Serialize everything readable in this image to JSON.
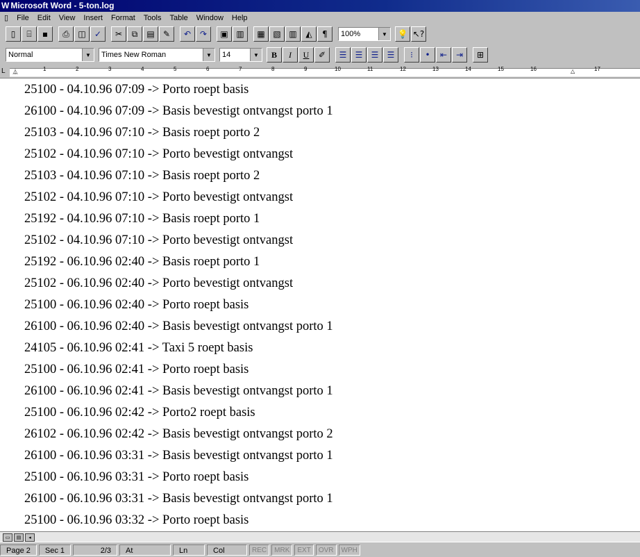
{
  "window": {
    "title": "Microsoft Word - 5-ton.log"
  },
  "menu": [
    "File",
    "Edit",
    "View",
    "Insert",
    "Format",
    "Tools",
    "Table",
    "Window",
    "Help"
  ],
  "toolbar_standard": {
    "icons": [
      "new-doc-icon",
      "open-icon",
      "save-icon",
      "print-icon",
      "print-preview-icon",
      "spelling-icon",
      "cut-icon",
      "copy-icon",
      "paste-icon",
      "format-painter-icon",
      "undo-icon",
      "redo-icon",
      "autoformat-icon",
      "insert-address-icon",
      "insert-table-icon",
      "insert-excel-icon",
      "columns-icon",
      "drawing-icon",
      "show-hide-icon",
      "help-icon"
    ],
    "zoom": "100%"
  },
  "toolbar_formatting": {
    "style": "Normal",
    "font": "Times New Roman",
    "size": "14",
    "bold": "B",
    "italic": "I",
    "underline": "U"
  },
  "ruler": {
    "numbers": [
      "1",
      "2",
      "3",
      "4",
      "5",
      "6",
      "7",
      "8",
      "9",
      "10",
      "11",
      "12",
      "13",
      "14",
      "15",
      "16",
      "17"
    ]
  },
  "document": {
    "lines": [
      "25100 - 04.10.96 07:09 -> Porto roept basis",
      "26100 - 04.10.96 07:09 -> Basis bevestigt ontvangst porto 1",
      "25103 - 04.10.96 07:10 -> Basis roept porto 2",
      "25102 - 04.10.96 07:10 -> Porto bevestigt ontvangst",
      "25103 - 04.10.96 07:10 -> Basis roept porto 2",
      "25102 - 04.10.96 07:10 -> Porto bevestigt ontvangst",
      "25192 - 04.10.96 07:10 -> Basis roept porto 1",
      "25102 - 04.10.96 07:10 -> Porto bevestigt ontvangst",
      "25192 - 06.10.96 02:40 -> Basis roept porto 1",
      "25102 - 06.10.96 02:40 -> Porto bevestigt ontvangst",
      "25100 - 06.10.96 02:40 -> Porto roept basis",
      "26100 - 06.10.96 02:40 -> Basis bevestigt ontvangst porto 1",
      "24105 - 06.10.96 02:41 -> Taxi 5 roept basis",
      "25100 - 06.10.96 02:41 -> Porto roept basis",
      "26100 - 06.10.96 02:41 -> Basis bevestigt ontvangst porto 1",
      "25100 - 06.10.96 02:42 -> Porto2 roept basis",
      "26102 - 06.10.96 02:42 -> Basis bevestigt ontvangst porto 2",
      "26100 - 06.10.96 03:31 -> Basis bevestigt ontvangst porto 1",
      "25100 - 06.10.96 03:31 -> Porto roept basis",
      "26100 - 06.10.96 03:31 -> Basis bevestigt ontvangst porto 1",
      "25100 - 06.10.96 03:32 -> Porto roept basis"
    ]
  },
  "status": {
    "page": "Page 2",
    "sec": "Sec 1",
    "pages": "2/3",
    "at": "At",
    "ln": "Ln",
    "col": "Col",
    "indicators": [
      "REC",
      "MRK",
      "EXT",
      "OVR",
      "WPH"
    ]
  }
}
